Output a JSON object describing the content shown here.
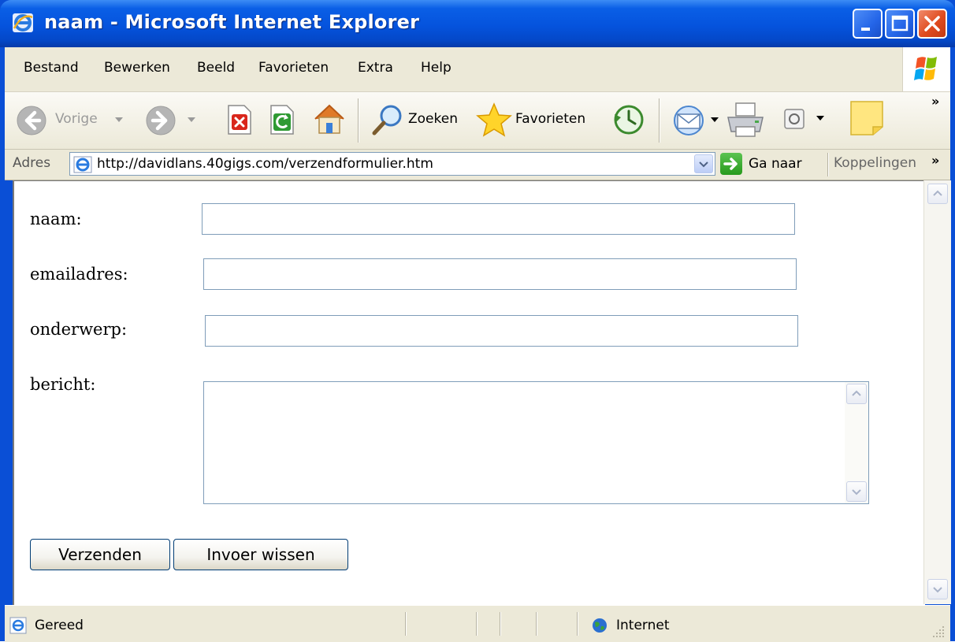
{
  "window": {
    "title": "naam - Microsoft Internet Explorer"
  },
  "menu": {
    "items": [
      "Bestand",
      "Bewerken",
      "Beeld",
      "Favorieten",
      "Extra",
      "Help"
    ]
  },
  "toolbar": {
    "back_label": "Vorige",
    "search_label": "Zoeken",
    "favorites_label": "Favorieten",
    "back_enabled": false,
    "forward_enabled": false
  },
  "addressbar": {
    "label": "Adres",
    "url": "http://davidlans.40gigs.com/verzendformulier.htm",
    "go_label": "Ga naar",
    "links_label": "Koppelingen"
  },
  "form": {
    "name_label": "naam:",
    "email_label": "emailadres:",
    "subject_label": "onderwerp:",
    "message_label": "bericht:",
    "name_value": "",
    "email_value": "",
    "subject_value": "",
    "message_value": "",
    "submit_label": "Verzenden",
    "reset_label": "Invoer wissen"
  },
  "status": {
    "text": "Gereed",
    "zone": "Internet"
  },
  "colors": {
    "titlebar": "#0553dd",
    "chrome": "#ece9d8",
    "close_button": "#e04b1f",
    "input_border": "#7f9db9"
  }
}
